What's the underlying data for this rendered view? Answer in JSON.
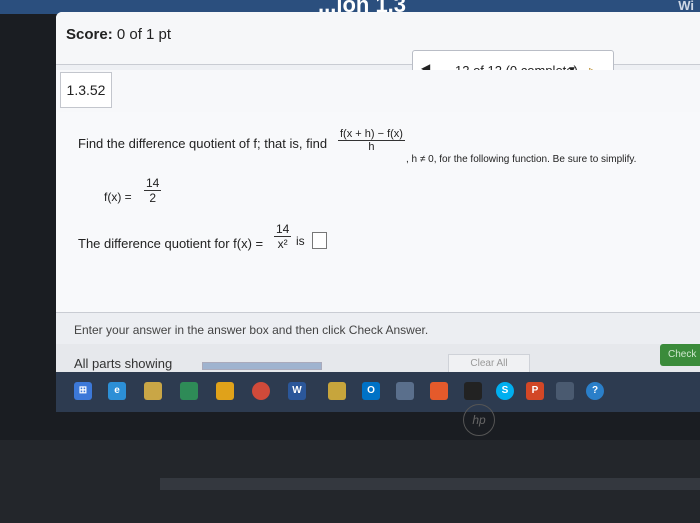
{
  "header": {
    "section_title": "...ion 1.3",
    "corner_link": "Wi"
  },
  "score": {
    "label": "Score:",
    "value": "0 of 1 pt"
  },
  "nav": {
    "prev_icon": "left-triangle-icon",
    "position": "12 of 12 (0 complete)",
    "dropdown_icon": "down-triangle-icon",
    "next_icon": "next-icon"
  },
  "question": {
    "number": "1.3.52",
    "instruction_pre": "Find the difference quotient of f; that is, find",
    "dq_num": "f(x + h) − f(x)",
    "dq_den": "h",
    "condition": ", h ≠ 0, for the following function. Be sure to simplify.",
    "fx_label": "f(x) =",
    "fx_num": "14",
    "fx_den": "2",
    "answer_pre": "The difference quotient for f(x) =",
    "ans_num": "14",
    "ans_den": "x²",
    "answer_post": "is"
  },
  "hint": "Enter your answer in the answer box and then click Check Answer.",
  "footer": {
    "parts": "All parts showing",
    "progress": 1.0,
    "clear": "Clear All",
    "check": "Check"
  },
  "taskbar": {
    "icons": [
      "windows-icon",
      "ie-icon",
      "folder-icon",
      "store-icon",
      "chrome-icon",
      "word-icon",
      "pen-icon",
      "outlook-icon",
      "media-icon",
      "app-icon",
      "mail-icon",
      "skype-icon",
      "powerpoint-icon",
      "camera-icon",
      "help-icon"
    ]
  },
  "brand": "hp"
}
